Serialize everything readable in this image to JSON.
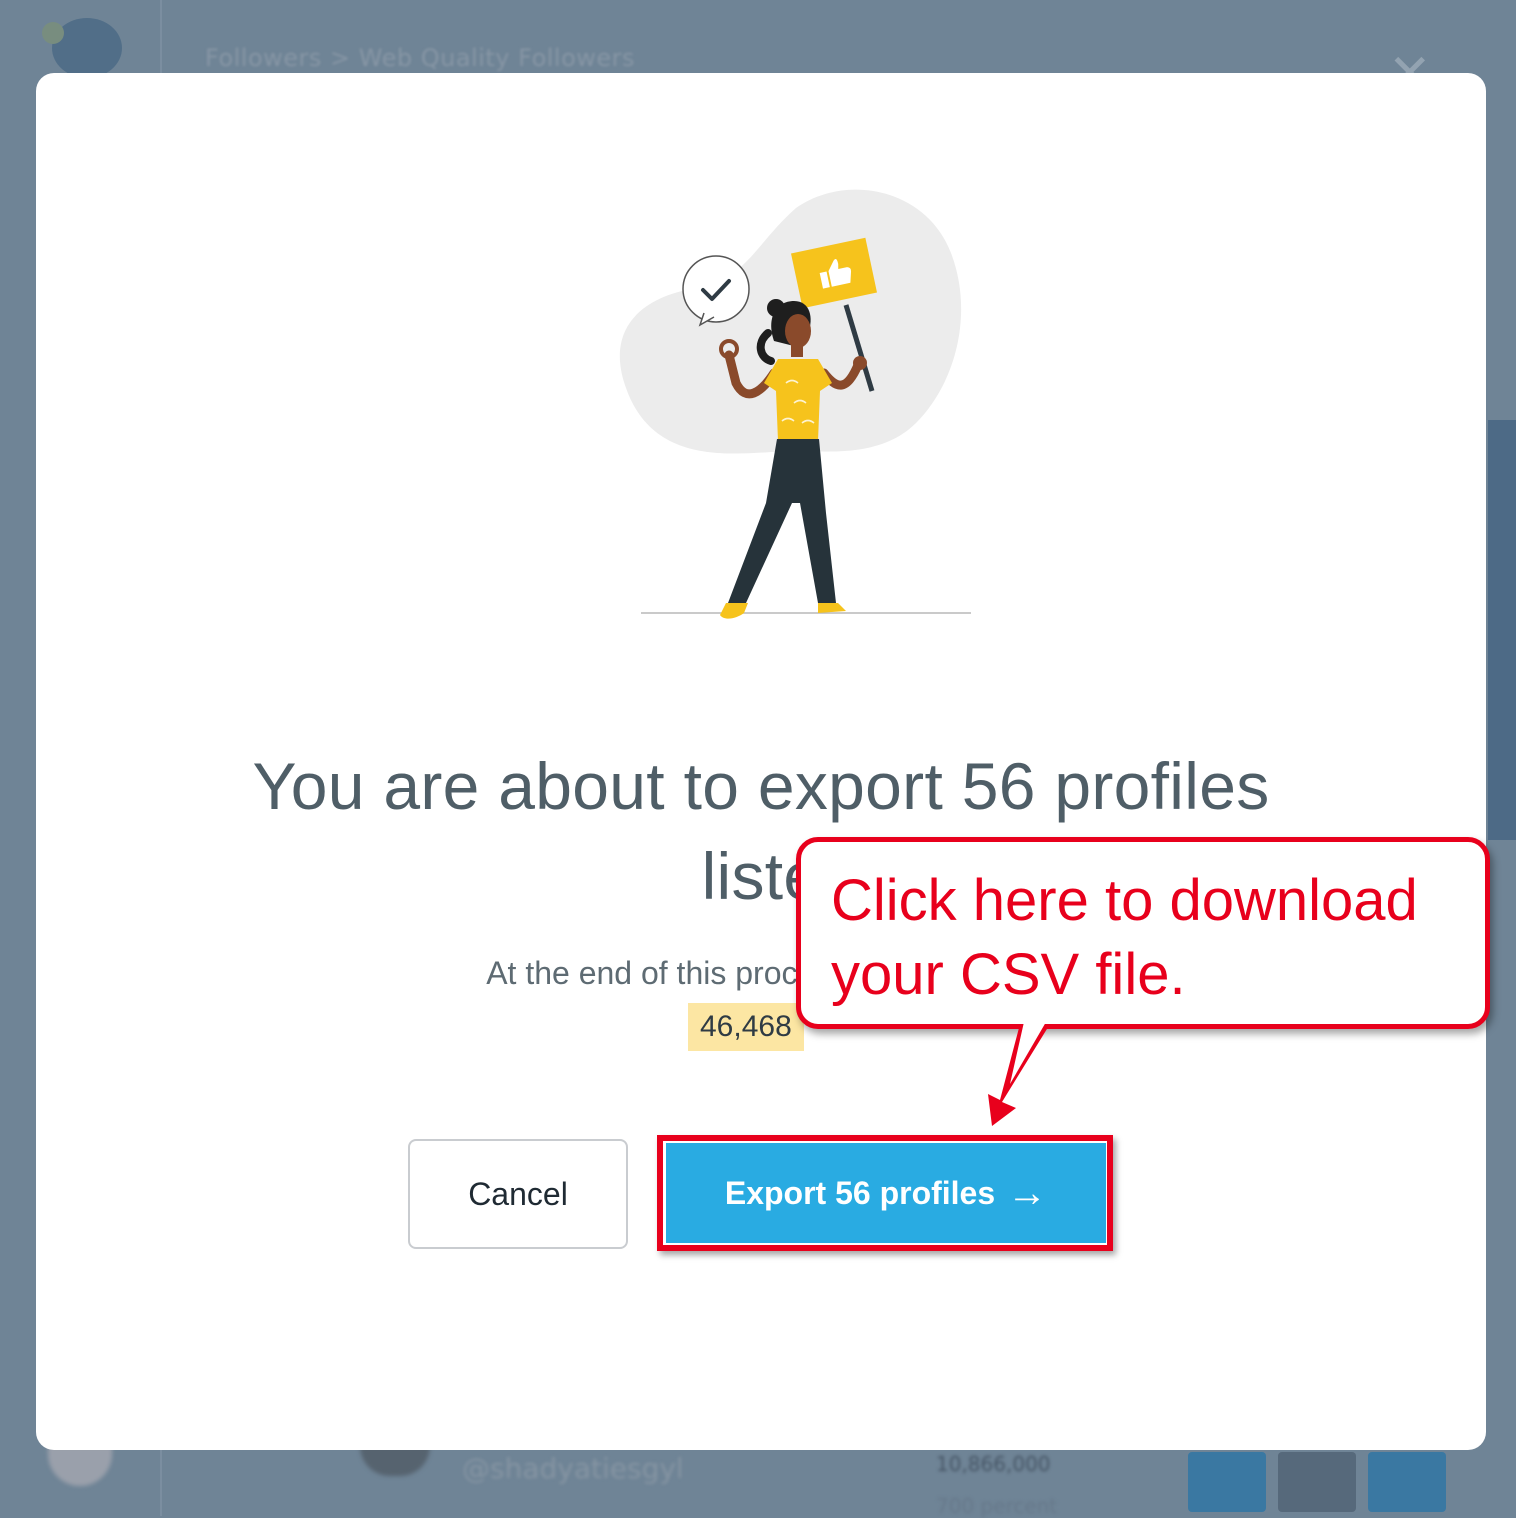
{
  "background": {
    "breadcrumb": "Followers > Web Quality Followers",
    "handle": "@shadyatiesgyl",
    "stat_primary": "10,866,000",
    "stat_secondary": "700 percent"
  },
  "modal": {
    "title_line1": "You are about to export 56 profiles",
    "title_line2": "liste",
    "description": "At the end of this process, your current",
    "credit_balance": "46,468",
    "cancel_label": "Cancel",
    "export_label": "Export 56 profiles",
    "export_arrow": "→"
  },
  "annotation": {
    "callout_line1": "Click here to download",
    "callout_line2": "your CSV file."
  },
  "colors": {
    "accent": "#29abe2",
    "annotation_red": "#e8001c",
    "illustration_yellow": "#f6c31c",
    "backdrop": "#6f8496",
    "credits_highlight": "#fce6a3"
  }
}
